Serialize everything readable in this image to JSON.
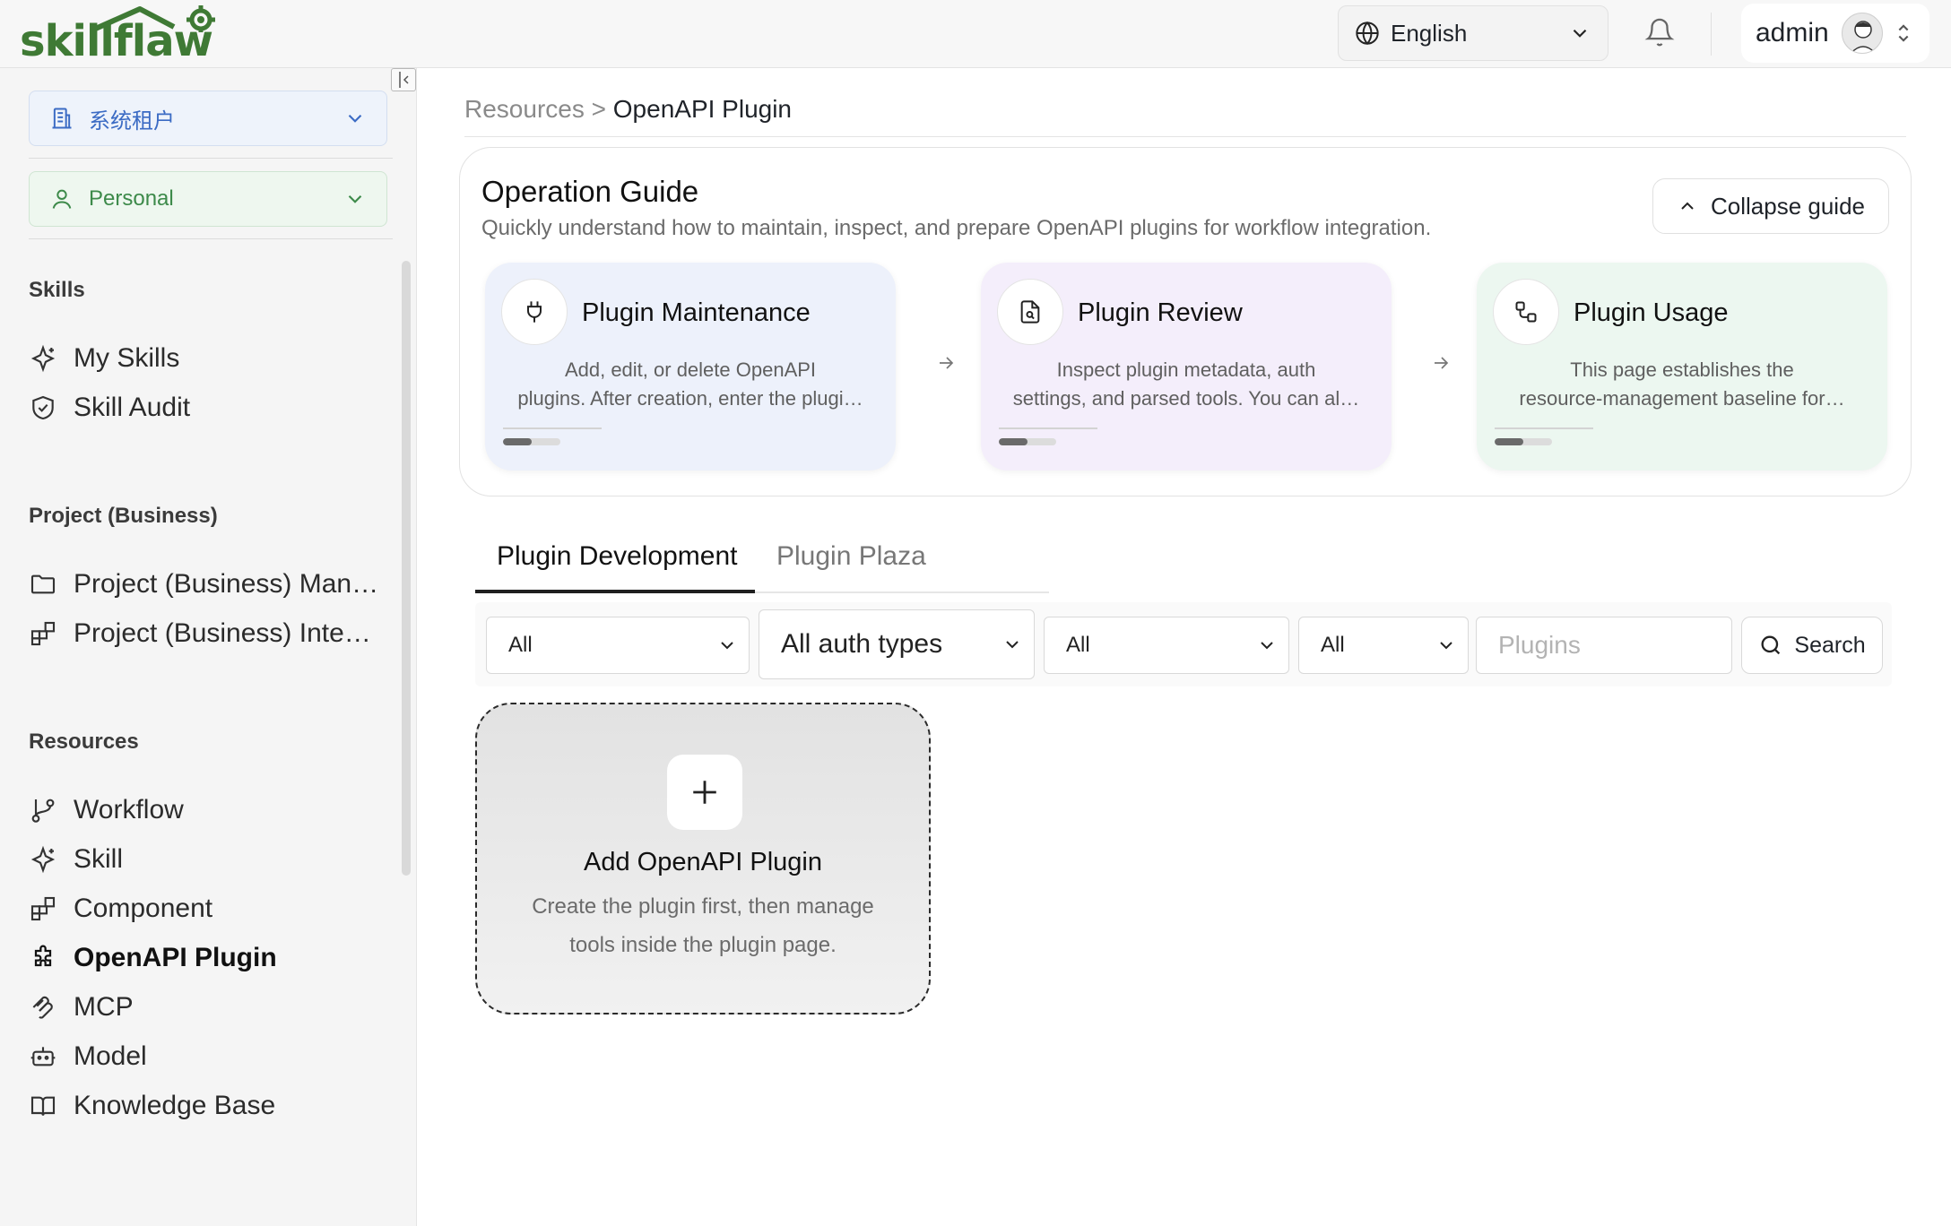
{
  "app": {
    "logo_text": "skillflaw",
    "brand_color": "#3f7a35"
  },
  "header": {
    "language": "English",
    "username": "admin",
    "icons": [
      "globe-icon",
      "chevron-down-icon",
      "bell-icon",
      "avatar",
      "chevron-updown-icon"
    ]
  },
  "sidebar": {
    "tenant": "系统租户",
    "workspace": "Personal",
    "sections": {
      "skills": "Skills",
      "project": "Project (Business)",
      "resources": "Resources"
    },
    "skills_items": [
      {
        "label": "My Skills",
        "icon": "sparkle-icon"
      },
      {
        "label": "Skill Audit",
        "icon": "shield-check-icon"
      }
    ],
    "project_items": [
      {
        "label": "Project (Business) Man…",
        "icon": "folder-icon"
      },
      {
        "label": "Project (Business) Inte…",
        "icon": "blocks-icon"
      }
    ],
    "resource_items": [
      {
        "label": "Workflow",
        "icon": "git-branch-icon"
      },
      {
        "label": "Skill",
        "icon": "sparkle-icon"
      },
      {
        "label": "Component",
        "icon": "blocks-icon"
      },
      {
        "label": "OpenAPI Plugin",
        "icon": "puzzle-icon",
        "active": true
      },
      {
        "label": "MCP",
        "icon": "mcp-icon"
      },
      {
        "label": "Model",
        "icon": "bot-icon"
      },
      {
        "label": "Knowledge Base",
        "icon": "book-icon"
      }
    ]
  },
  "breadcrumb": {
    "parent": "Resources",
    "separator": " > ",
    "current": "OpenAPI Plugin"
  },
  "guide": {
    "title": "Operation Guide",
    "subtitle": "Quickly understand how to maintain, inspect, and prepare OpenAPI plugins for workflow integration.",
    "collapse_label": "Collapse guide",
    "cards": [
      {
        "title": "Plugin Maintenance",
        "icon": "plug-icon",
        "desc_line1": "Add, edit, or delete OpenAPI",
        "desc_line2": "plugins. After creation, enter the plugi…",
        "progress": 0.5
      },
      {
        "title": "Plugin Review",
        "icon": "file-search-icon",
        "desc_line1": "Inspect plugin metadata, auth",
        "desc_line2": "settings, and parsed tools. You can al…",
        "progress": 0.5
      },
      {
        "title": "Plugin Usage",
        "icon": "route-icon",
        "desc_line1": "This page establishes the",
        "desc_line2": "resource-management baseline for…",
        "progress": 0.5
      }
    ]
  },
  "tabs": [
    {
      "label": "Plugin Development",
      "active": true
    },
    {
      "label": "Plugin Plaza",
      "active": false
    }
  ],
  "filters": {
    "filter1": "All",
    "auth_type": "All auth types",
    "filter3": "All",
    "filter4": "All",
    "search_placeholder": "Plugins",
    "search_value": "",
    "search_button": "Search"
  },
  "add_card": {
    "title": "Add OpenAPI Plugin",
    "desc_line1": "Create the plugin first, then manage",
    "desc_line2": "tools inside the plugin page."
  }
}
